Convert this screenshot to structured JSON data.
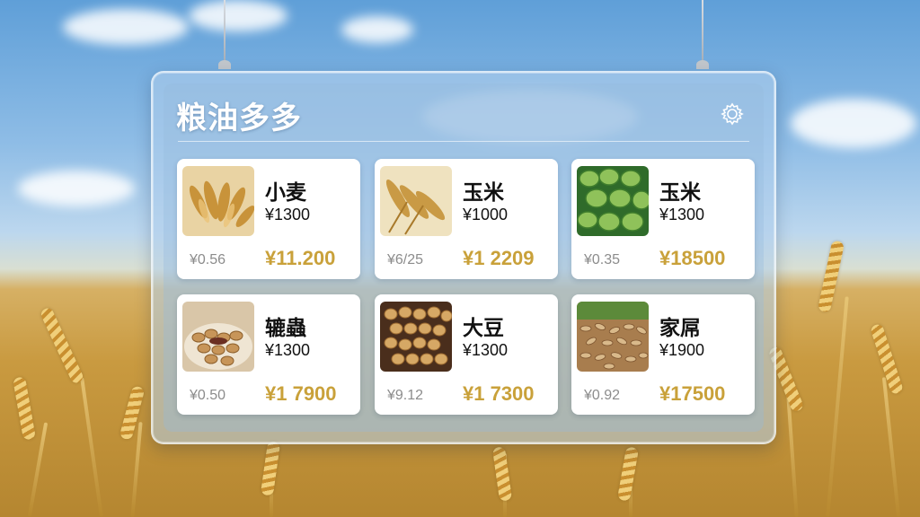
{
  "app": {
    "title": "粮油多多",
    "settings_icon": "gear-icon"
  },
  "colors": {
    "price_gold": "#c9a13a",
    "panel_glass": "#b2d0ec",
    "card_bg": "#ffffff"
  },
  "products": [
    {
      "name": "小麦",
      "price": "¥1300",
      "small_price": "¥0.56",
      "big_price": "¥11.200",
      "image": "wheat-image"
    },
    {
      "name": "玉米",
      "price": "¥1000",
      "small_price": "¥6/25",
      "big_price": "¥1 2209",
      "image": "wheat-ears-image"
    },
    {
      "name": "玉米",
      "price": "¥1300",
      "small_price": "¥0.35",
      "big_price": "¥18500",
      "image": "green-vegetables-image"
    },
    {
      "name": "辘蟲",
      "price": "¥1300",
      "small_price": "¥0.50",
      "big_price": "¥1 7900",
      "image": "peanuts-image"
    },
    {
      "name": "大豆",
      "price": "¥1300",
      "small_price": "¥9.12",
      "big_price": "¥1 7300",
      "image": "soybeans-image"
    },
    {
      "name": "家屌",
      "price": "¥1900",
      "small_price": "¥0.92",
      "big_price": "¥17500",
      "image": "mixed-grain-image"
    }
  ]
}
